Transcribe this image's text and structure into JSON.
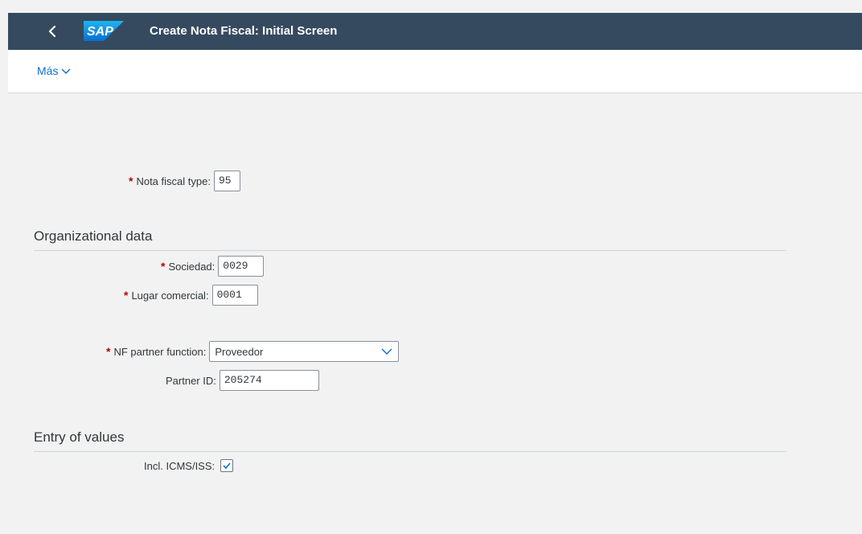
{
  "header": {
    "title": "Create Nota Fiscal: Initial Screen",
    "logo_text": "SAP",
    "back_icon": "chevron-left-icon"
  },
  "toolbar": {
    "more_label": "Más",
    "more_icon": "chevron-down-icon"
  },
  "form": {
    "nf_type": {
      "label": "Nota fiscal type:",
      "value": "95",
      "required": true
    },
    "org_section": {
      "title": "Organizational data"
    },
    "company": {
      "label": "Sociedad:",
      "value": "0029",
      "required": true
    },
    "business_place": {
      "label": "Lugar comercial:",
      "value": "0001",
      "required": true
    },
    "partner_function": {
      "label": "NF partner function:",
      "value": "Proveedor",
      "required": true
    },
    "partner_id": {
      "label": "Partner ID:",
      "value": "205274",
      "required": false
    },
    "entry_section": {
      "title": "Entry of values"
    },
    "incl_icms": {
      "label": "Incl. ICMS/ISS:",
      "checked": true
    }
  },
  "colors": {
    "shell": "#354a5f",
    "accent": "#0a6ed1",
    "required": "#bb0000"
  }
}
